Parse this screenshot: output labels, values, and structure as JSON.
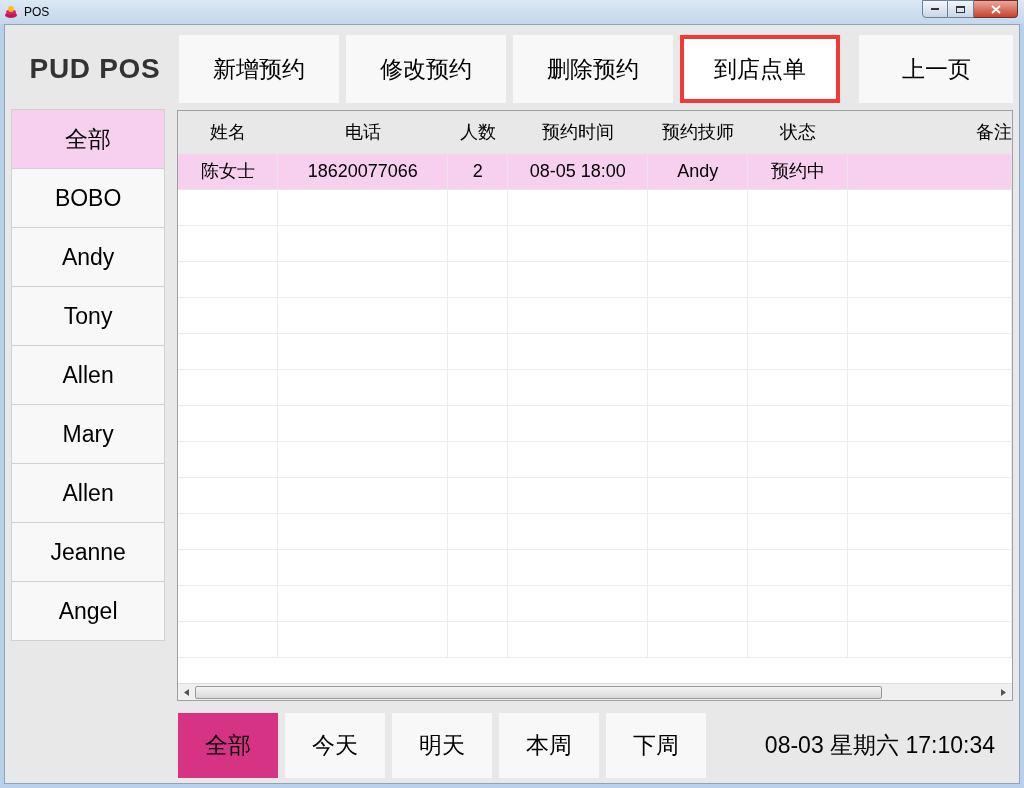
{
  "window": {
    "title": "POS"
  },
  "logo": "PUD POS",
  "actions": [
    {
      "label": "新增预约",
      "highlighted": false
    },
    {
      "label": "修改预约",
      "highlighted": false
    },
    {
      "label": "删除预约",
      "highlighted": false
    },
    {
      "label": "到店点单",
      "highlighted": true
    },
    {
      "label": "上一页",
      "highlighted": false
    }
  ],
  "sidebar": {
    "items": [
      {
        "label": "全部",
        "selected": true
      },
      {
        "label": "BOBO",
        "selected": false
      },
      {
        "label": "Andy",
        "selected": false
      },
      {
        "label": "Tony",
        "selected": false
      },
      {
        "label": "Allen",
        "selected": false
      },
      {
        "label": "Mary",
        "selected": false
      },
      {
        "label": "Allen",
        "selected": false
      },
      {
        "label": "Jeanne",
        "selected": false
      },
      {
        "label": "Angel",
        "selected": false
      }
    ]
  },
  "table": {
    "columns": [
      "姓名",
      "电话",
      "人数",
      "预约时间",
      "预约技师",
      "状态",
      "备注"
    ],
    "rows": [
      {
        "selected": true,
        "cells": [
          "陈女士",
          "18620077066",
          "2",
          "08-05 18:00",
          "Andy",
          "预约中",
          ""
        ]
      }
    ]
  },
  "filters": [
    {
      "label": "全部",
      "selected": true
    },
    {
      "label": "今天",
      "selected": false
    },
    {
      "label": "明天",
      "selected": false
    },
    {
      "label": "本周",
      "selected": false
    },
    {
      "label": "下周",
      "selected": false
    }
  ],
  "status_bar": {
    "clock": "08-03 星期六 17:10:34"
  }
}
